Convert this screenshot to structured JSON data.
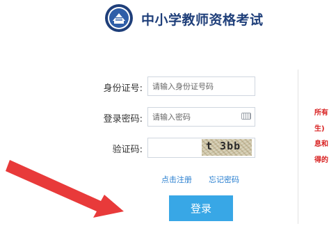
{
  "header": {
    "site_title": "中小学教师资格考试"
  },
  "form": {
    "id_label": "身份证号:",
    "id_placeholder": "请输入身份证号码",
    "password_label": "登录密码:",
    "password_placeholder": "请输入密码",
    "captcha_label": "验证码:",
    "captcha_value": "",
    "captcha_image_text": "t 3bb",
    "register_link": "点击注册",
    "forgot_link": "忘记密码",
    "login_button": "登录"
  },
  "notice": {
    "lines": [
      "所有",
      "生)",
      "息和",
      "得的"
    ],
    "color": "#d82020"
  },
  "colors": {
    "title": "#1f3f7a",
    "button": "#38a7e6",
    "link": "#2a7fd0",
    "annotation_arrow": "#e83a3a"
  }
}
